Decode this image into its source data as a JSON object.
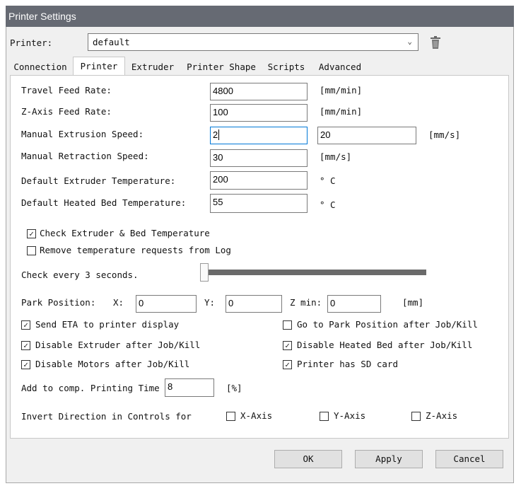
{
  "window": {
    "title": "Printer Settings"
  },
  "printer_select": {
    "label": "Printer:",
    "value": "default"
  },
  "tabs": [
    {
      "label": "Connection",
      "active": false
    },
    {
      "label": "Printer",
      "active": true
    },
    {
      "label": "Extruder",
      "active": false
    },
    {
      "label": "Printer Shape",
      "active": false
    },
    {
      "label": "Scripts",
      "active": false
    },
    {
      "label": "Advanced",
      "active": false
    }
  ],
  "settings": {
    "travel_feed_rate": {
      "label": "Travel Feed Rate:",
      "value": "4800",
      "unit": "[mm/min]"
    },
    "z_feed_rate": {
      "label": "Z-Axis Feed Rate:",
      "value": "100",
      "unit": "[mm/min]"
    },
    "manual_extrusion": {
      "label": "Manual Extrusion Speed:",
      "value": "2",
      "value2": "20",
      "unit": "[mm/s]"
    },
    "manual_retraction": {
      "label": "Manual Retraction Speed:",
      "value": "30",
      "unit": "[mm/s]"
    },
    "default_extruder_temp": {
      "label": "Default Extruder Temperature:",
      "value": "200",
      "unit": "° C"
    },
    "default_bed_temp": {
      "label": "Default Heated Bed Temperature:",
      "value": "55",
      "unit": "° C"
    }
  },
  "checks": {
    "check_temps": {
      "label": "Check Extruder & Bed Temperature",
      "checked": true
    },
    "remove_temp_requests": {
      "label": "Remove temperature requests from Log",
      "checked": false
    }
  },
  "check_every": {
    "label": "Check every 3 seconds.",
    "slider_fraction": 0.03
  },
  "park": {
    "label": "Park Position:",
    "x_label": "X:",
    "x_value": "0",
    "y_label": "Y:",
    "y_value": "0",
    "z_label": "Z min:",
    "z_value": "0",
    "unit": "[mm]"
  },
  "options": {
    "send_eta": {
      "label": "Send ETA to printer display",
      "checked": true
    },
    "go_to_park": {
      "label": "Go to Park Position after Job/Kill",
      "checked": false
    },
    "disable_extruder": {
      "label": "Disable Extruder after Job/Kill",
      "checked": true
    },
    "disable_bed": {
      "label": "Disable Heated Bed after Job/Kill",
      "checked": true
    },
    "disable_motors": {
      "label": "Disable Motors after Job/Kill",
      "checked": true
    },
    "has_sd": {
      "label": "Printer has SD card",
      "checked": true
    }
  },
  "comp_time": {
    "label": "Add to comp. Printing Time",
    "value": "8",
    "unit": "[%]"
  },
  "invert": {
    "label": "Invert Direction in Controls for",
    "x_label": "X-Axis",
    "x_checked": false,
    "y_label": "Y-Axis",
    "y_checked": false,
    "z_label": "Z-Axis",
    "z_checked": false
  },
  "buttons": {
    "ok": "OK",
    "apply": "Apply",
    "cancel": "Cancel"
  },
  "icons": {
    "dropdown": "chevron-down-icon",
    "delete": "trash-icon",
    "check": "checkmark-icon"
  }
}
